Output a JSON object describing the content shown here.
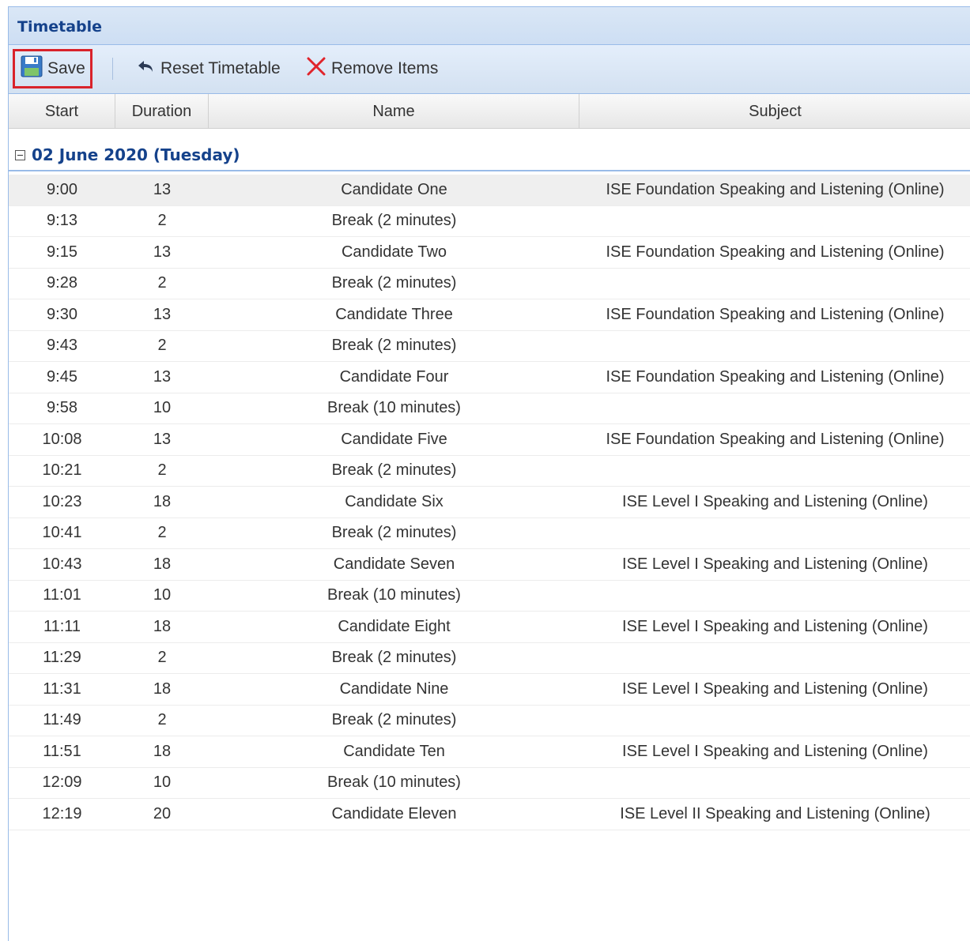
{
  "panel": {
    "title": "Timetable"
  },
  "toolbar": {
    "save_label": "Save",
    "reset_label": "Reset Timetable",
    "remove_label": "Remove Items",
    "icons": {
      "save": "floppy-disk-icon",
      "reset": "undo-arrow-icon",
      "remove": "red-x-icon"
    }
  },
  "grid": {
    "columns": [
      "Start",
      "Duration",
      "Name",
      "Subject"
    ],
    "group_label": "02 June 2020 (Tuesday)",
    "rows": [
      {
        "start": "9:00",
        "duration": "13",
        "name": "Candidate One",
        "subject": "ISE Foundation Speaking and Listening (Online)"
      },
      {
        "start": "9:13",
        "duration": "2",
        "name": "Break (2 minutes)",
        "subject": ""
      },
      {
        "start": "9:15",
        "duration": "13",
        "name": "Candidate Two",
        "subject": "ISE Foundation Speaking and Listening (Online)"
      },
      {
        "start": "9:28",
        "duration": "2",
        "name": "Break (2 minutes)",
        "subject": ""
      },
      {
        "start": "9:30",
        "duration": "13",
        "name": "Candidate Three",
        "subject": "ISE Foundation Speaking and Listening (Online)"
      },
      {
        "start": "9:43",
        "duration": "2",
        "name": "Break (2 minutes)",
        "subject": ""
      },
      {
        "start": "9:45",
        "duration": "13",
        "name": "Candidate Four",
        "subject": "ISE Foundation Speaking and Listening (Online)"
      },
      {
        "start": "9:58",
        "duration": "10",
        "name": "Break (10 minutes)",
        "subject": ""
      },
      {
        "start": "10:08",
        "duration": "13",
        "name": "Candidate Five",
        "subject": "ISE Foundation Speaking and Listening (Online)"
      },
      {
        "start": "10:21",
        "duration": "2",
        "name": "Break (2 minutes)",
        "subject": ""
      },
      {
        "start": "10:23",
        "duration": "18",
        "name": "Candidate Six",
        "subject": "ISE Level I Speaking and Listening (Online)"
      },
      {
        "start": "10:41",
        "duration": "2",
        "name": "Break (2 minutes)",
        "subject": ""
      },
      {
        "start": "10:43",
        "duration": "18",
        "name": "Candidate Seven",
        "subject": "ISE Level I Speaking and Listening (Online)"
      },
      {
        "start": "11:01",
        "duration": "10",
        "name": "Break (10 minutes)",
        "subject": ""
      },
      {
        "start": "11:11",
        "duration": "18",
        "name": "Candidate Eight",
        "subject": "ISE Level I Speaking and Listening (Online)"
      },
      {
        "start": "11:29",
        "duration": "2",
        "name": "Break (2 minutes)",
        "subject": ""
      },
      {
        "start": "11:31",
        "duration": "18",
        "name": "Candidate Nine",
        "subject": "ISE Level I Speaking and Listening (Online)"
      },
      {
        "start": "11:49",
        "duration": "2",
        "name": "Break (2 minutes)",
        "subject": ""
      },
      {
        "start": "11:51",
        "duration": "18",
        "name": "Candidate Ten",
        "subject": "ISE Level I Speaking and Listening (Online)"
      },
      {
        "start": "12:09",
        "duration": "10",
        "name": "Break (10 minutes)",
        "subject": ""
      },
      {
        "start": "12:19",
        "duration": "20",
        "name": "Candidate Eleven",
        "subject": "ISE Level II Speaking and Listening (Online)"
      }
    ]
  },
  "colors": {
    "title_text": "#15428b",
    "panel_border": "#99bbe8",
    "save_highlight": "#d9232b",
    "remove_icon": "#e0242b"
  }
}
